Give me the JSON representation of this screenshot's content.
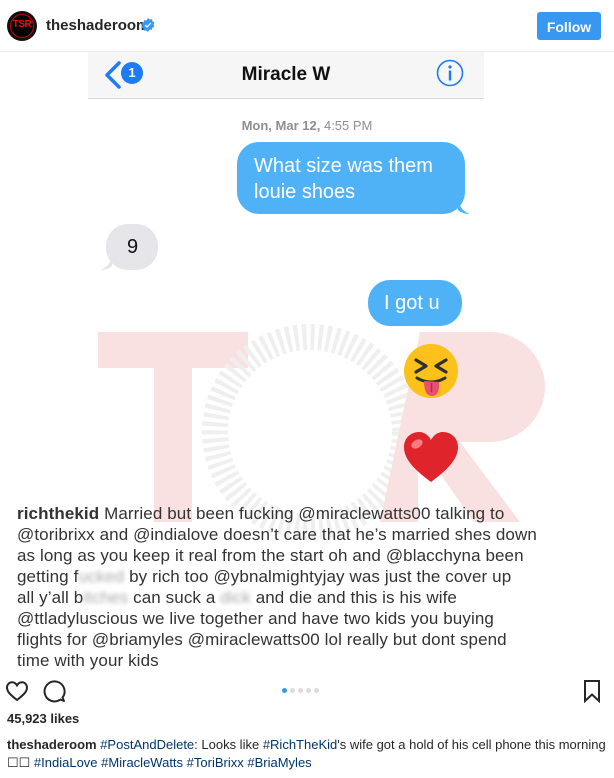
{
  "header": {
    "avatar_text": "TSR",
    "username": "theshaderoom",
    "follow_label": "Follow"
  },
  "post_image": {
    "phone": {
      "unread_count": "1",
      "contact_name": "Miracle W"
    },
    "timestamp_day": "Mon, Mar 12,",
    "timestamp_time": "4:55 PM",
    "messages": [
      {
        "side": "sent",
        "text_line1": "What size was them",
        "text_line2": "louie shoes"
      },
      {
        "side": "received",
        "text": "9"
      },
      {
        "side": "sent",
        "text": "I got u"
      }
    ],
    "emojis": [
      "squinting-tongue-emoji",
      "heart-emoji"
    ],
    "watermark_text": "TSR",
    "overlay_caption": {
      "user": "richthekid",
      "line1_rest": "Married but been fucking @miraclewatts00 talking to",
      "line2": "@toribrixx and @indialove doesn’t care that he’s married shes down",
      "line3": "as long as you keep it real from the start oh and @blacchyna been",
      "line4_a": "getting f",
      "line4_blur": "ucked",
      "line4_b": " by rich too @ybnalmightyjay was just the cover up",
      "line5_a": "all y’all b",
      "line5_blur": "itches",
      "line5_b": " can suck a ",
      "line5_blur2": "dick",
      "line5_c": " and die and this is his wife",
      "line6": "@ttladyluscious we live together and have two kids you buying",
      "line7": "flights for @briamyles @miraclewatts00 lol really but dont spend",
      "line8": "time with your kids"
    }
  },
  "actions": {
    "carousel_dots": 5,
    "active_dot": 0
  },
  "likes": "45,923 likes",
  "caption": {
    "user": "theshaderoom",
    "tag1": "#PostAndDelete",
    "text1": ": Looks like ",
    "tag2": "#RichTheKid",
    "text2": "'s wife got a hold of his cell phone this",
    "text3": "morning ☐☐ ",
    "tag3": "#IndiaLove",
    "tag4": "#MiracleWatts",
    "tag5": "#ToriBrixx",
    "tag6": "#BriaMyles"
  },
  "colors": {
    "follow_blue": "#3897f0",
    "imessage_blue": "#4fb2f7",
    "received_gray": "#e5e5ea",
    "hashtag": "#003569"
  }
}
